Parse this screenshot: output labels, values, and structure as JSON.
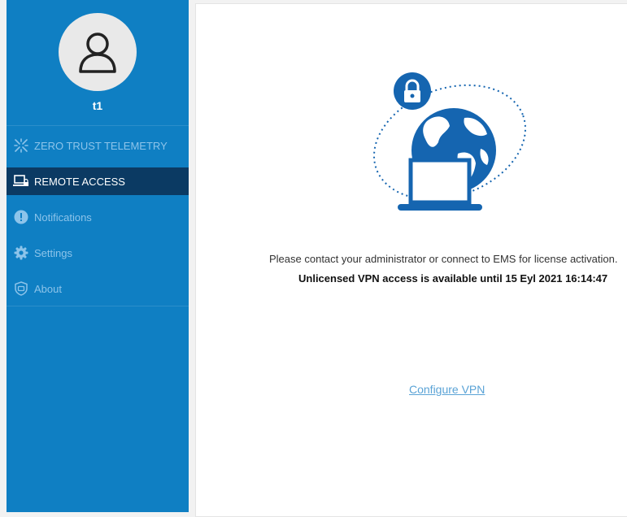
{
  "user": {
    "name": "t1",
    "avatar_icon": "user-icon"
  },
  "sidebar": {
    "items": [
      {
        "label": "ZERO TRUST TELEMETRY",
        "icon": "telemetry-icon"
      },
      {
        "label": "REMOTE ACCESS",
        "icon": "remote-access-icon",
        "active": true
      },
      {
        "label": "Notifications",
        "icon": "notification-icon"
      },
      {
        "label": "Settings",
        "icon": "gear-icon"
      },
      {
        "label": "About",
        "icon": "shield-icon"
      }
    ]
  },
  "main": {
    "illustration_icon": "vpn-globe-laptop-lock-illustration",
    "license_message": "Please contact your administrator or connect to EMS for license activation.",
    "vpn_message": "Unlicensed VPN access is available until 15 Eyl 2021 16:14:47",
    "configure_link": "Configure VPN"
  },
  "colors": {
    "sidebar_bg": "#0f7fc3",
    "active_item_bg": "#0b3a63",
    "inactive_text": "#8dc4ea",
    "illustration_blue": "#1565b0",
    "link": "#5aa3d6"
  }
}
